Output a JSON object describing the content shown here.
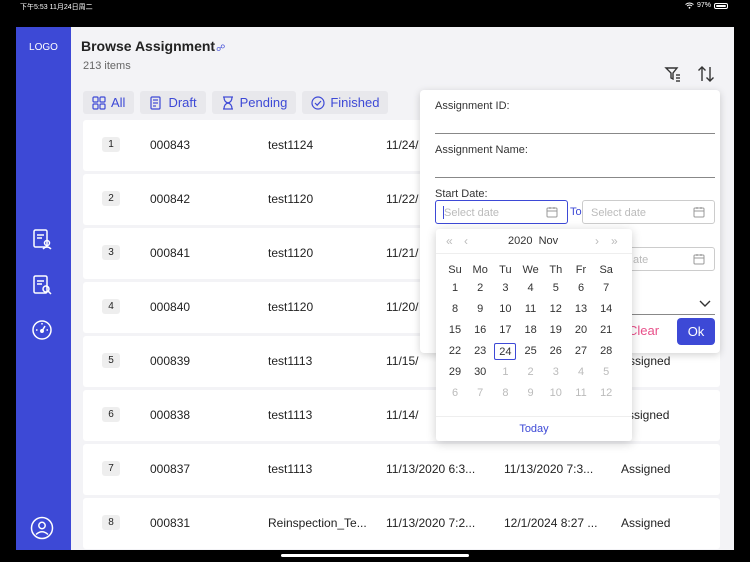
{
  "status_bar": {
    "time_date": "下午5:53   11月24日周二",
    "battery": "97%",
    "battery_level": 0.97
  },
  "sidebar": {
    "logo": "LOGO"
  },
  "header": {
    "title": "Browse Assignment",
    "count": "213 items"
  },
  "tabs": [
    {
      "label": "All",
      "icon": "grid-icon"
    },
    {
      "label": "Draft",
      "icon": "document-icon"
    },
    {
      "label": "Pending",
      "icon": "hourglass-icon"
    },
    {
      "label": "Finished",
      "icon": "check-circle-icon"
    }
  ],
  "rows": [
    {
      "num": "1",
      "id": "000843",
      "name": "test1124",
      "start": "11/24/",
      "end": "",
      "status": ""
    },
    {
      "num": "2",
      "id": "000842",
      "name": "test1120",
      "start": "11/22/",
      "end": "",
      "status": ""
    },
    {
      "num": "3",
      "id": "000841",
      "name": "test1120",
      "start": "11/21/",
      "end": "",
      "status": ""
    },
    {
      "num": "4",
      "id": "000840",
      "name": "test1120",
      "start": "11/20/",
      "end": "",
      "status": ""
    },
    {
      "num": "5",
      "id": "000839",
      "name": "test1113",
      "start": "11/15/",
      "end": "",
      "status": "Assigned"
    },
    {
      "num": "6",
      "id": "000838",
      "name": "test1113",
      "start": "11/14/",
      "end": "",
      "status": "ssigned"
    },
    {
      "num": "7",
      "id": "000837",
      "name": "test1113",
      "start": "11/13/2020 6:3...",
      "end": "11/13/2020 7:3...",
      "status": "Assigned"
    },
    {
      "num": "8",
      "id": "000831",
      "name": "Reinspection_Te...",
      "start": "11/13/2020 7:2...",
      "end": "12/1/2024 8:27 ...",
      "status": "Assigned"
    }
  ],
  "filter": {
    "id_label": "Assignment ID:",
    "name_label": "Assignment Name:",
    "start_label": "Start Date:",
    "date_placeholder": "Select date",
    "to_label": "To",
    "hidden_placeholder": "ate",
    "clear": "Clear",
    "ok": "Ok"
  },
  "calendar": {
    "year": "2020",
    "month": "Nov",
    "nav_prev_year": "«",
    "nav_prev_month": "‹",
    "nav_next_month": "›",
    "nav_next_year": "»",
    "weekdays": [
      "Su",
      "Mo",
      "Tu",
      "We",
      "Th",
      "Fr",
      "Sa"
    ],
    "days": [
      "1",
      "2",
      "3",
      "4",
      "5",
      "6",
      "7",
      "8",
      "9",
      "10",
      "11",
      "12",
      "13",
      "14",
      "15",
      "16",
      "17",
      "18",
      "19",
      "20",
      "21",
      "22",
      "23",
      "24",
      "25",
      "26",
      "27",
      "28",
      "29",
      "30",
      "1",
      "2",
      "3",
      "4",
      "5",
      "6",
      "7",
      "8",
      "9",
      "10",
      "11",
      "12"
    ],
    "current_month_days": 30,
    "today_day": "24",
    "today_label": "Today"
  },
  "colors": {
    "primary": "#3d49d6",
    "clear": "#e8508a",
    "background": "#f3f3f6"
  }
}
